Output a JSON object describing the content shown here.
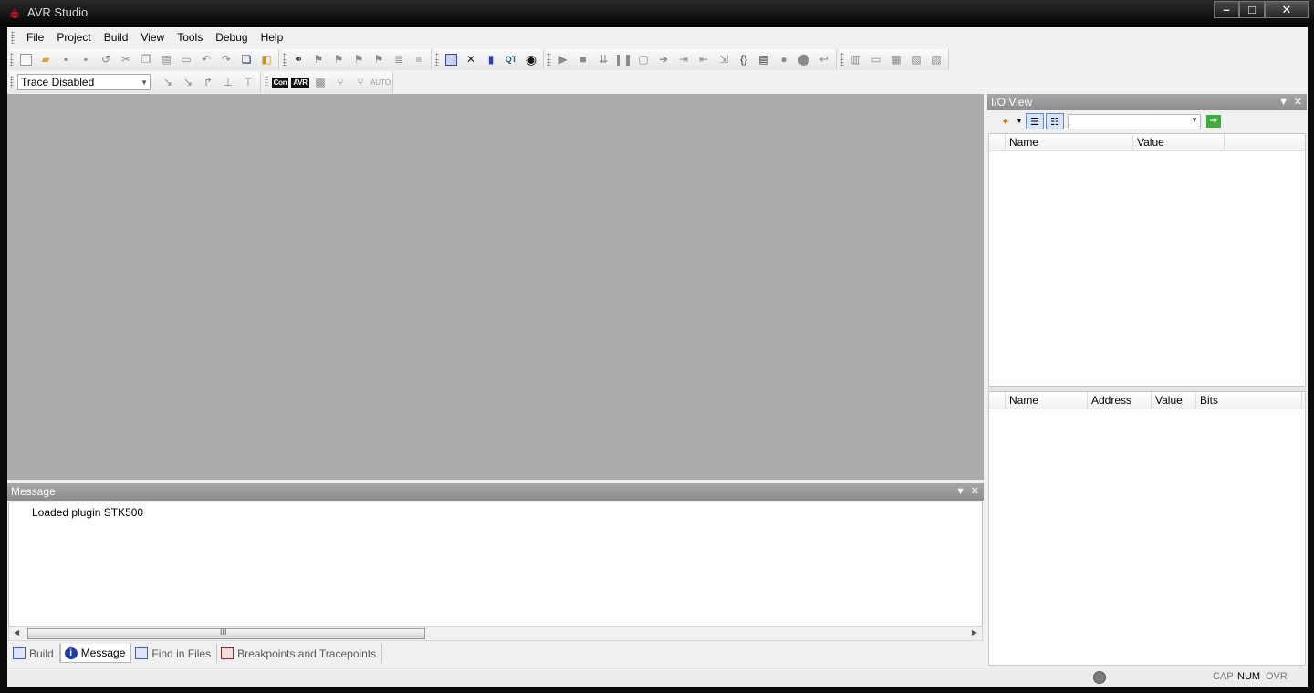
{
  "window": {
    "title": "AVR Studio",
    "close_glyph": "✕",
    "max_glyph": "□",
    "min_glyph": "–"
  },
  "menu": [
    "File",
    "Project",
    "Build",
    "View",
    "Tools",
    "Debug",
    "Help"
  ],
  "toolbar": {
    "trace_select": "Trace Disabled",
    "tags": {
      "con": "Con",
      "avr": "AVR",
      "auto": "AUTO",
      "qt": "QT"
    }
  },
  "message_pane": {
    "title": "Message",
    "lines": [
      "Loaded plugin STK500"
    ],
    "tabs": [
      "Build",
      "Message",
      "Find in Files",
      "Breakpoints and Tracepoints"
    ],
    "active_tab": "Message",
    "scroll_grip": "III"
  },
  "io_view": {
    "title": "I/O View",
    "top_columns": [
      "Name",
      "Value"
    ],
    "bottom_columns": [
      "Name",
      "Address",
      "Value",
      "Bits"
    ]
  },
  "statusbar": {
    "cap": "CAP",
    "num": "NUM",
    "ovr": "OVR"
  },
  "colors": {
    "mdi_background": "#ababab",
    "pane_header": "#9a9a9a",
    "title_bar": "#0b0b0b"
  }
}
